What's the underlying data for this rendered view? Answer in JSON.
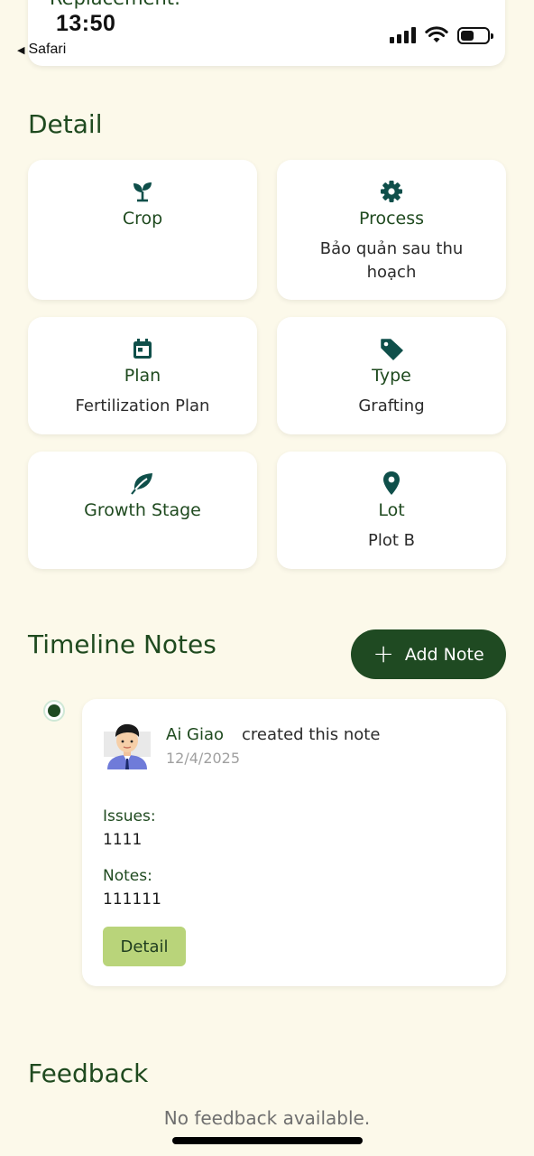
{
  "status_bar": {
    "time": "13:50",
    "back_label": "Safari",
    "back_icon": "back-triangle-icon"
  },
  "top_card": {
    "title": "Replacement:"
  },
  "detail": {
    "title": "Detail",
    "cards": [
      {
        "icon": "sprout-icon",
        "label": "Crop",
        "value": ""
      },
      {
        "icon": "gear-icon",
        "label": "Process",
        "value": "Bảo quản sau thu hoạch"
      },
      {
        "icon": "calendar-icon",
        "label": "Plan",
        "value": "Fertilization Plan"
      },
      {
        "icon": "tag-icon",
        "label": "Type",
        "value": "Grafting"
      },
      {
        "icon": "leaf-icon",
        "label": "Growth Stage",
        "value": ""
      },
      {
        "icon": "location-pin-icon",
        "label": "Lot",
        "value": "Plot B"
      }
    ]
  },
  "timeline": {
    "title": "Timeline Notes",
    "add_note_label": "Add Note",
    "notes": [
      {
        "author": "Ai Giao",
        "action": "created this note",
        "date": "12/4/2025",
        "issues_label": "Issues:",
        "issues_value": "1111",
        "notes_label": "Notes:",
        "notes_value": "111111",
        "detail_label": "Detail"
      }
    ]
  },
  "feedback": {
    "title": "Feedback",
    "empty_text": "No feedback available."
  },
  "colors": {
    "background": "#fcf9ea",
    "primary_dark_green": "#1f4a22",
    "icon_teal": "#0f4f4a",
    "detail_button": "#b9d47a"
  }
}
